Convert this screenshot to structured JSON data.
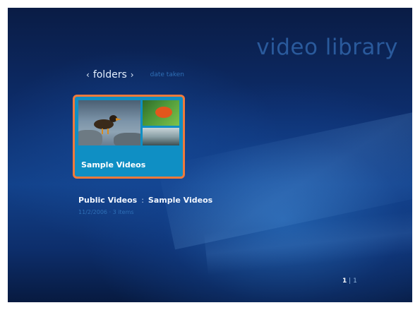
{
  "page_title": "video library",
  "nav": {
    "current": "folders",
    "left_chevron": "‹",
    "right_chevron": "›",
    "secondary": "date taken"
  },
  "tile": {
    "label": "Sample Videos",
    "highlight_color": "#f07a3a",
    "fill_color": "#0f8fc4"
  },
  "details": {
    "path_parent": "Public Videos",
    "path_separator": ":",
    "path_current": "Sample Videos",
    "meta": "11/2/2006 · 3 items"
  },
  "pager": {
    "current": "1",
    "separator": "|",
    "total": "1"
  }
}
